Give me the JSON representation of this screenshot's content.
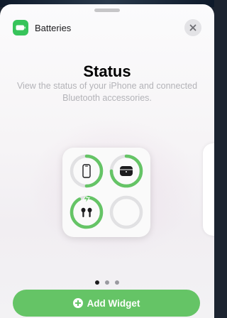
{
  "header": {
    "app_name": "Batteries"
  },
  "main": {
    "title": "Status",
    "subtitle": "View the status of your iPhone and connected Bluetooth accessories."
  },
  "widget": {
    "devices": [
      {
        "name": "iphone-icon",
        "level": 0.5
      },
      {
        "name": "airpods-case-icon",
        "level": 0.75
      },
      {
        "name": "airpods-icon",
        "level": 0.92,
        "charging": true
      },
      {
        "name": "empty-slot",
        "level": 0
      }
    ],
    "ring_color": "#65c466",
    "track_color": "#e1e1e3"
  },
  "pager": {
    "page_count": 3,
    "active_page": 1
  },
  "footer": {
    "add_widget_label": "Add Widget",
    "button_color": "#65c466"
  }
}
